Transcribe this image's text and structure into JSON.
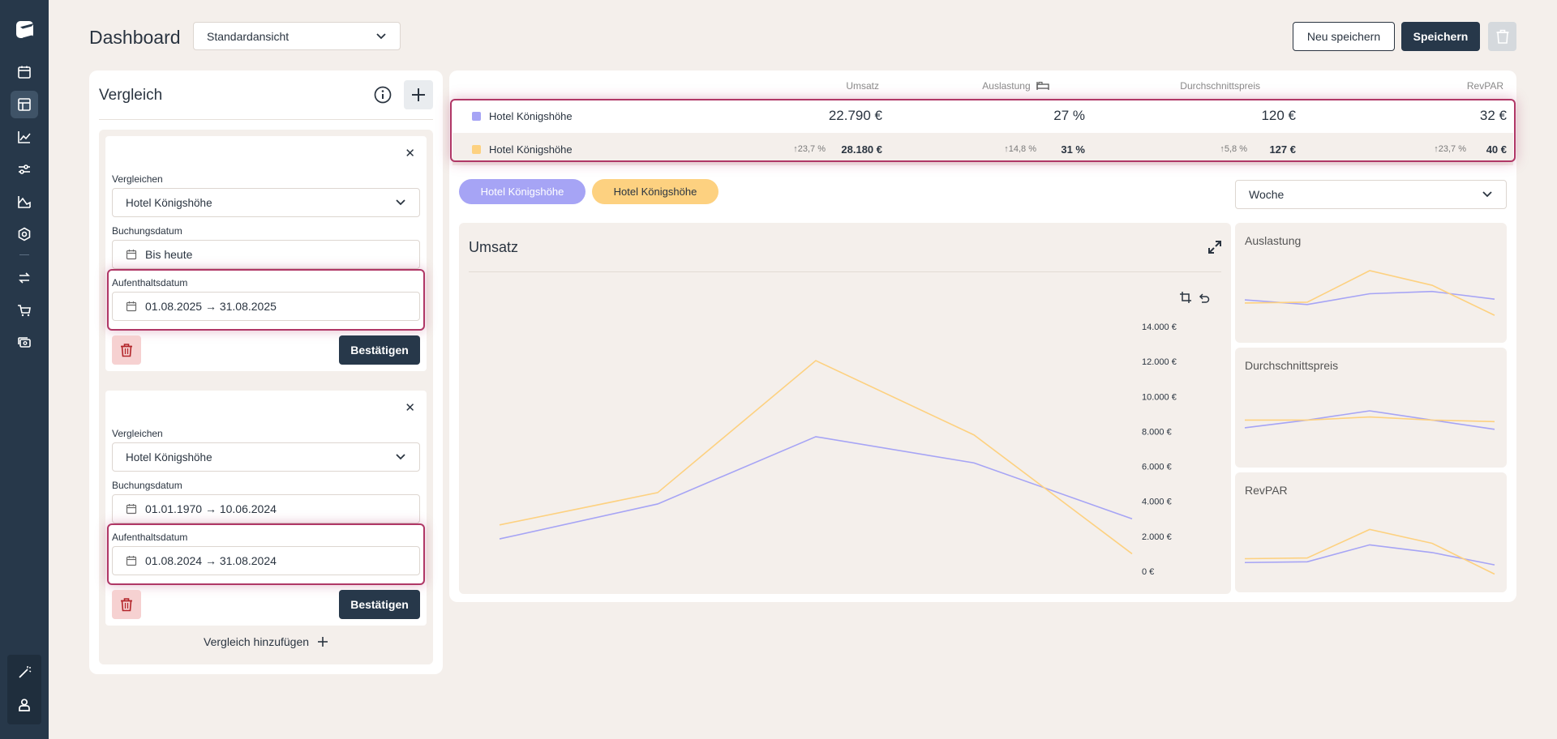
{
  "header": {
    "title": "Dashboard",
    "view_select": "Standardansicht",
    "save_new": "Neu speichern",
    "save": "Speichern"
  },
  "comparison": {
    "title": "Vergleich",
    "add_label": "Vergleich hinzufügen",
    "cards": [
      {
        "compare_label": "Vergleichen",
        "compare_value": "Hotel Königshöhe",
        "booking_label": "Buchungsdatum",
        "booking_value": "Bis heute",
        "stay_label": "Aufenthaltsdatum",
        "stay_value": "01.08.2025 → 31.08.2025",
        "confirm": "Bestätigen"
      },
      {
        "compare_label": "Vergleichen",
        "compare_value": "Hotel Königshöhe",
        "booking_label": "Buchungsdatum",
        "booking_value": "01.01.1970 → 10.06.2024",
        "stay_label": "Aufenthaltsdatum",
        "stay_value": "01.08.2024 → 31.08.2024",
        "confirm": "Bestätigen"
      }
    ]
  },
  "stats": {
    "headers": [
      "Umsatz",
      "Auslastung",
      "Durchschnittspreis",
      "RevPAR"
    ],
    "rows": [
      {
        "name": "Hotel Königshöhe",
        "color": "#a6a4f5",
        "values": [
          "22.790 €",
          "27 %",
          "120 €",
          "32 €"
        ]
      },
      {
        "name": "Hotel Königshöhe",
        "color": "#fdd180",
        "values": [
          "28.180 €",
          "31 %",
          "127 €",
          "40 €"
        ],
        "trends": [
          "↑23,7 %",
          "↑14,8 %",
          "↑5,8 %",
          "↑23,7 %"
        ]
      }
    ]
  },
  "legend": [
    "Hotel Königshöhe",
    "Hotel Königshöhe"
  ],
  "period": "Woche",
  "chart_data": [
    {
      "type": "line",
      "title": "Umsatz",
      "ylim": [
        0,
        14000
      ],
      "yticks": [
        "0 €",
        "2.000 €",
        "4.000 €",
        "6.000 €",
        "8.000 €",
        "10.000 €",
        "12.000 €",
        "14.000 €"
      ],
      "x": [
        1,
        2,
        3,
        4,
        5
      ],
      "series": [
        {
          "color": "#a6a4f5",
          "values": [
            1850,
            3850,
            7700,
            6200,
            3000
          ]
        },
        {
          "color": "#fdd180",
          "values": [
            2650,
            4500,
            12050,
            7800,
            1000
          ]
        }
      ]
    },
    {
      "type": "line",
      "title": "Auslastung",
      "x": [
        1,
        2,
        3,
        4,
        5
      ],
      "series": [
        {
          "color": "#a6a4f5",
          "values": [
            0.42,
            0.36,
            0.5,
            0.53,
            0.43
          ]
        },
        {
          "color": "#fdd180",
          "values": [
            0.38,
            0.39,
            0.8,
            0.61,
            0.22
          ]
        }
      ]
    },
    {
      "type": "line",
      "title": "Durchschnittspreis",
      "x": [
        1,
        2,
        3,
        4,
        5
      ],
      "series": [
        {
          "color": "#a6a4f5",
          "values": [
            0.38,
            0.48,
            0.6,
            0.48,
            0.36
          ]
        },
        {
          "color": "#fdd180",
          "values": [
            0.48,
            0.48,
            0.52,
            0.48,
            0.46
          ]
        }
      ]
    },
    {
      "type": "line",
      "title": "RevPAR",
      "x": [
        1,
        2,
        3,
        4,
        5
      ],
      "series": [
        {
          "color": "#a6a4f5",
          "values": [
            0.25,
            0.26,
            0.48,
            0.38,
            0.22
          ]
        },
        {
          "color": "#fdd180",
          "values": [
            0.3,
            0.31,
            0.68,
            0.5,
            0.1
          ]
        }
      ]
    }
  ]
}
